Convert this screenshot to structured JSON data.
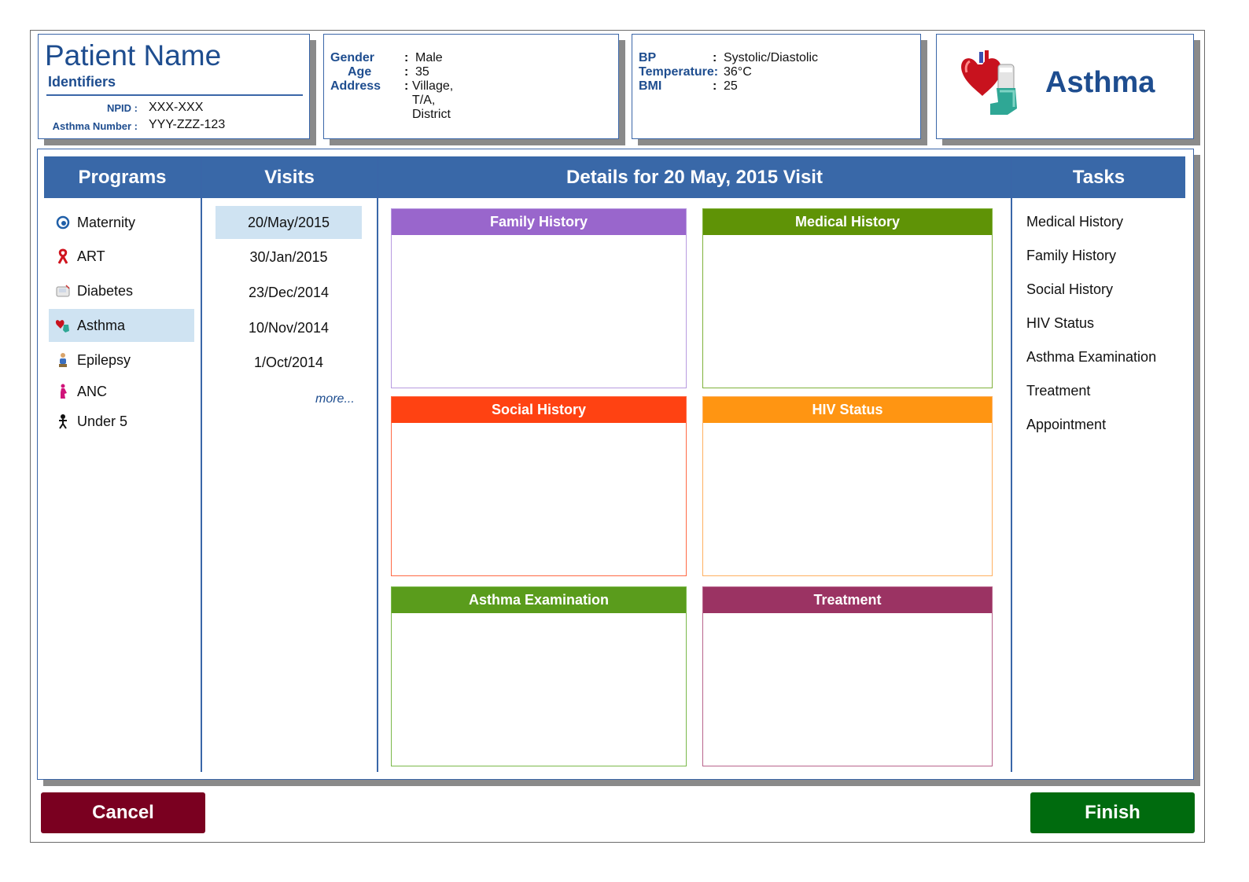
{
  "patient": {
    "name": "Patient Name",
    "identifiers_heading": "Identifiers",
    "npid_label": "NPID :",
    "npid_value": "XXX-XXX",
    "asthma_number_label": "Asthma Number :",
    "asthma_number_value": "YYY-ZZZ-123"
  },
  "demographics": {
    "gender_label": "Gender",
    "gender_value": "Male",
    "age_label": "Age",
    "age_value": "35",
    "address_label": "Address",
    "address_line1": "Village,",
    "address_line2": "T/A,",
    "address_line3": "District",
    "colon": ":"
  },
  "vitals": {
    "bp_label": "BP",
    "bp_value": "Systolic/Diastolic",
    "temp_label": "Temperature:",
    "temp_value": "36°C",
    "bmi_label": "BMI",
    "bmi_value": "25",
    "colon": ":"
  },
  "program_banner": {
    "title": "Asthma",
    "icon": "heart-inhaler-icon"
  },
  "columns": {
    "programs": "Programs",
    "visits": "Visits",
    "details": "Details for 20 May, 2015 Visit",
    "tasks": "Tasks"
  },
  "programs": [
    {
      "label": "Maternity",
      "icon": "maternity-icon"
    },
    {
      "label": "ART",
      "icon": "red-ribbon-icon"
    },
    {
      "label": "Diabetes",
      "icon": "glucometer-icon"
    },
    {
      "label": "Asthma",
      "icon": "heart-inhaler-icon",
      "selected": true
    },
    {
      "label": "Epilepsy",
      "icon": "seated-person-icon"
    },
    {
      "label": "ANC",
      "icon": "pregnant-woman-icon"
    },
    {
      "label": "Under 5",
      "icon": "child-icon"
    }
  ],
  "visits": {
    "items": [
      "20/May/2015",
      "30/Jan/2015",
      "23/Dec/2014",
      "10/Nov/2014",
      "1/Oct/2014"
    ],
    "selected_index": 0,
    "more_label": "more..."
  },
  "details": [
    {
      "title": "Family History",
      "color": "#9966cc"
    },
    {
      "title": "Medical History",
      "color": "#5f9306"
    },
    {
      "title": "Social History",
      "color": "#ff4212"
    },
    {
      "title": "HIV Status",
      "color": "#ff9512"
    },
    {
      "title": "Asthma Examination",
      "color": "#5a9c1c"
    },
    {
      "title": "Treatment",
      "color": "#9b3363"
    }
  ],
  "tasks": [
    "Medical History",
    "Family History",
    "Social History",
    "HIV Status",
    "Asthma Examination",
    "Treatment",
    "Appointment"
  ],
  "buttons": {
    "cancel": "Cancel",
    "finish": "Finish",
    "cancel_color": "#7a0020",
    "finish_color": "#006b0e"
  },
  "theme": {
    "header_blue": "#3968a8",
    "selection_blue": "#cfe3f2",
    "text_blue": "#1e4d8f"
  }
}
